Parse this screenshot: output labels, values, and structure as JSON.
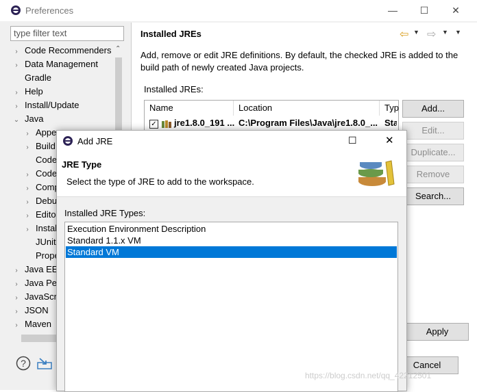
{
  "preferences": {
    "title": "Preferences",
    "filter_placeholder": "type filter text",
    "tree_items": [
      {
        "label": "Code Recommenders",
        "twisty": "›"
      },
      {
        "label": "Data Management",
        "twisty": "›"
      },
      {
        "label": "Gradle",
        "twisty": ""
      },
      {
        "label": "Help",
        "twisty": "›"
      },
      {
        "label": "Install/Update",
        "twisty": "›"
      },
      {
        "label": "Java",
        "twisty": "⌄"
      },
      {
        "label": "Appe",
        "twisty": "›"
      },
      {
        "label": "Build",
        "twisty": "›"
      },
      {
        "label": "Code",
        "twisty": ""
      },
      {
        "label": "Code",
        "twisty": "›"
      },
      {
        "label": "Comp",
        "twisty": "›"
      },
      {
        "label": "Debu",
        "twisty": "›"
      },
      {
        "label": "Edito",
        "twisty": "›"
      },
      {
        "label": "Instal",
        "twisty": "›"
      },
      {
        "label": "JUnit",
        "twisty": ""
      },
      {
        "label": "Prope",
        "twisty": ""
      },
      {
        "label": "Java EE",
        "twisty": "›"
      },
      {
        "label": "Java Per",
        "twisty": "›"
      },
      {
        "label": "JavaScri",
        "twisty": "›"
      },
      {
        "label": "JSON",
        "twisty": "›"
      },
      {
        "label": "Maven",
        "twisty": "›"
      }
    ],
    "page_title": "Installed JREs",
    "description": "Add, remove or edit JRE definitions. By default, the checked JRE is added to the build path of newly created Java projects.",
    "installed_label": "Installed JREs:",
    "columns": [
      "Name",
      "Location",
      "Typ"
    ],
    "row": {
      "name": "jre1.8.0_191 ...",
      "location": "C:\\Program Files\\Java\\jre1.8.0_...",
      "type": "Sta"
    },
    "buttons": {
      "add": "Add...",
      "edit": "Edit...",
      "duplicate": "Duplicate...",
      "remove": "Remove",
      "search": "Search...",
      "apply": "Apply",
      "cancel": "Cancel"
    }
  },
  "dialog": {
    "title": "Add JRE",
    "heading": "JRE Type",
    "subtitle": "Select the type of JRE to add to the workspace.",
    "types_label": "Installed JRE Types:",
    "types": [
      "Execution Environment Description",
      "Standard 1.1.x VM",
      "Standard VM"
    ],
    "selected_index": 2
  },
  "watermark": "https://blog.csdn.net/qq_42212501",
  "colors": {
    "selection": "#0078d7"
  }
}
